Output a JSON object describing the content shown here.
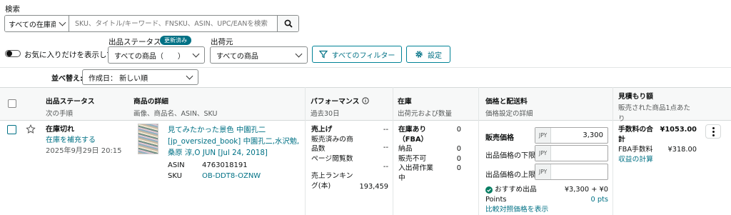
{
  "search": {
    "label": "検索",
    "scope": "すべての在庫商",
    "placeholder": "SKU、タイトル/キーワード、FNSKU、ASIN、UPC/EANを検索"
  },
  "filters": {
    "status_label": "出品ステータス",
    "status_badge": "更新済み",
    "status_value": "すべての商品（　　）",
    "ship_label": "出荷元",
    "ship_value": "すべての商品",
    "favorites_label": "お気に入りだけを表示して",
    "all_filters": "すべてのフィルター",
    "settings": "設定"
  },
  "sort": {
    "label": "並べ替え:",
    "value": "作成日： 新しい順"
  },
  "columns": [
    {
      "title": "出品ステータス",
      "sub": "次の手順"
    },
    {
      "title": "商品の詳細",
      "sub": "画像、商品名、ASIN、SKU"
    },
    {
      "title": "パフォーマンス",
      "sub": "過去30日"
    },
    {
      "title": "在庫",
      "sub": "出荷元および数量"
    },
    {
      "title": "価格と配送料",
      "sub": "価格設定の詳細"
    },
    {
      "title": "見積もり額",
      "sub": "販売された商品1点あたり"
    }
  ],
  "item": {
    "status": "在庫切れ",
    "action": "在庫を補充する",
    "date": "2025年9月29日 20:15",
    "title": "見てみたかった景色 中園孔二 [jp_oversized_book] 中園孔二,水沢勉,桑原 淳,O JUN [Jul 24, 2018]",
    "asin_label": "ASIN",
    "asin": "4763018191",
    "sku_label": "SKU",
    "sku": "OB-DDT8-OZNW",
    "perf": [
      {
        "label": "売上げ",
        "value": "--"
      },
      {
        "label": "販売済みの商品数",
        "value": "--"
      },
      {
        "label": "ページ閲覧数",
        "value": "--"
      },
      {
        "label": "売上ランキング(本)",
        "value": "193,459"
      }
    ],
    "inv": [
      {
        "label": "在庫あり（FBA）",
        "value": "0"
      },
      {
        "label": "納品",
        "value": "0"
      },
      {
        "label": "販売不可",
        "value": "0"
      },
      {
        "label": "入出荷作業中",
        "value": "0"
      }
    ],
    "price_label": "販売価格",
    "currency": "JPY",
    "price": "3,300",
    "min_label": "出品価格の下限",
    "max_label": "出品価格の上限",
    "featured_label": "おすすめ出品",
    "featured_value": "¥3,300 + ¥0",
    "points_label": "Points",
    "points_value": "0 pts",
    "compare_link": "比較対照価格を表示",
    "fee_total_label": "手数料の合計",
    "fee_total": "¥1053.00",
    "fba_fee_label": "FBA手数料",
    "fba_fee": "¥318.00",
    "profit_link": "収益の計算"
  }
}
